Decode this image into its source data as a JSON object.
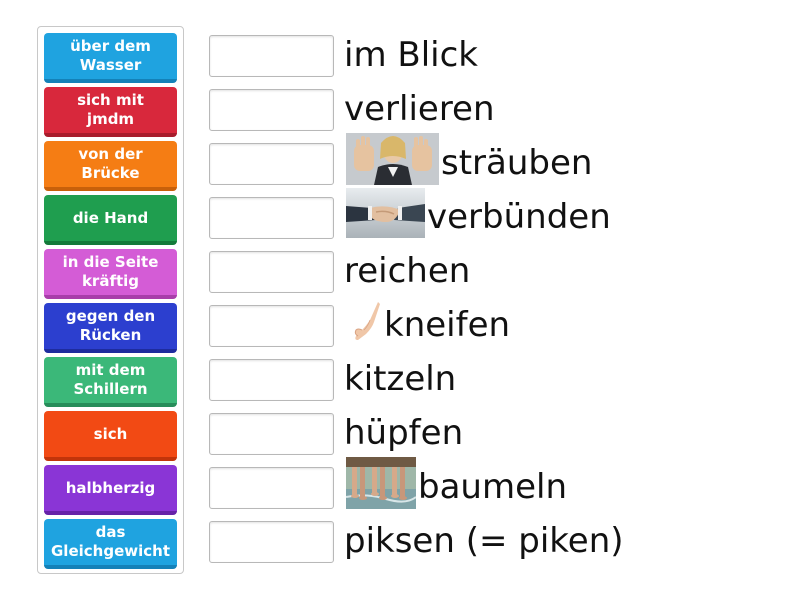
{
  "tiles": [
    {
      "label": "über dem\nWasser",
      "color": "#1fa3e0",
      "bottom": "#1481b8"
    },
    {
      "label": "sich mit\njmdm",
      "color": "#d8283c",
      "bottom": "#a81c2c"
    },
    {
      "label": "von der\nBrücke",
      "color": "#f57d14",
      "bottom": "#c8600a"
    },
    {
      "label": "die Hand",
      "color": "#1f9e4f",
      "bottom": "#147a3a"
    },
    {
      "label": "in die Seite\nkräftig",
      "color": "#d45cd6",
      "bottom": "#a83eaa"
    },
    {
      "label": "gegen den\nRücken",
      "color": "#2c3fcf",
      "bottom": "#1e2c9e"
    },
    {
      "label": "mit dem\nSchillern",
      "color": "#3bb879",
      "bottom": "#278d5a"
    },
    {
      "label": "sich",
      "color": "#f24a14",
      "bottom": "#c2340a"
    },
    {
      "label": "halbherzig",
      "color": "#8a35d6",
      "bottom": "#6622a8"
    },
    {
      "label": "das\nGleichgewicht",
      "color": "#1fa3e0",
      "bottom": "#1481b8"
    }
  ],
  "rows": [
    {
      "text": "im Blick",
      "image": null
    },
    {
      "text": "verlieren",
      "image": null
    },
    {
      "text": "sträuben",
      "image": "stop-hands-woman-photo"
    },
    {
      "text": "verbünden",
      "image": "handshake-photo"
    },
    {
      "text": "reichen",
      "image": null
    },
    {
      "text": "kneifen",
      "image": "pinching-fingers-photo"
    },
    {
      "text": "kitzeln",
      "image": null
    },
    {
      "text": "hüpfen",
      "image": null
    },
    {
      "text": "baumeln",
      "image": "dangling-legs-photo"
    },
    {
      "text": "piksen (= piken)",
      "image": null
    }
  ]
}
